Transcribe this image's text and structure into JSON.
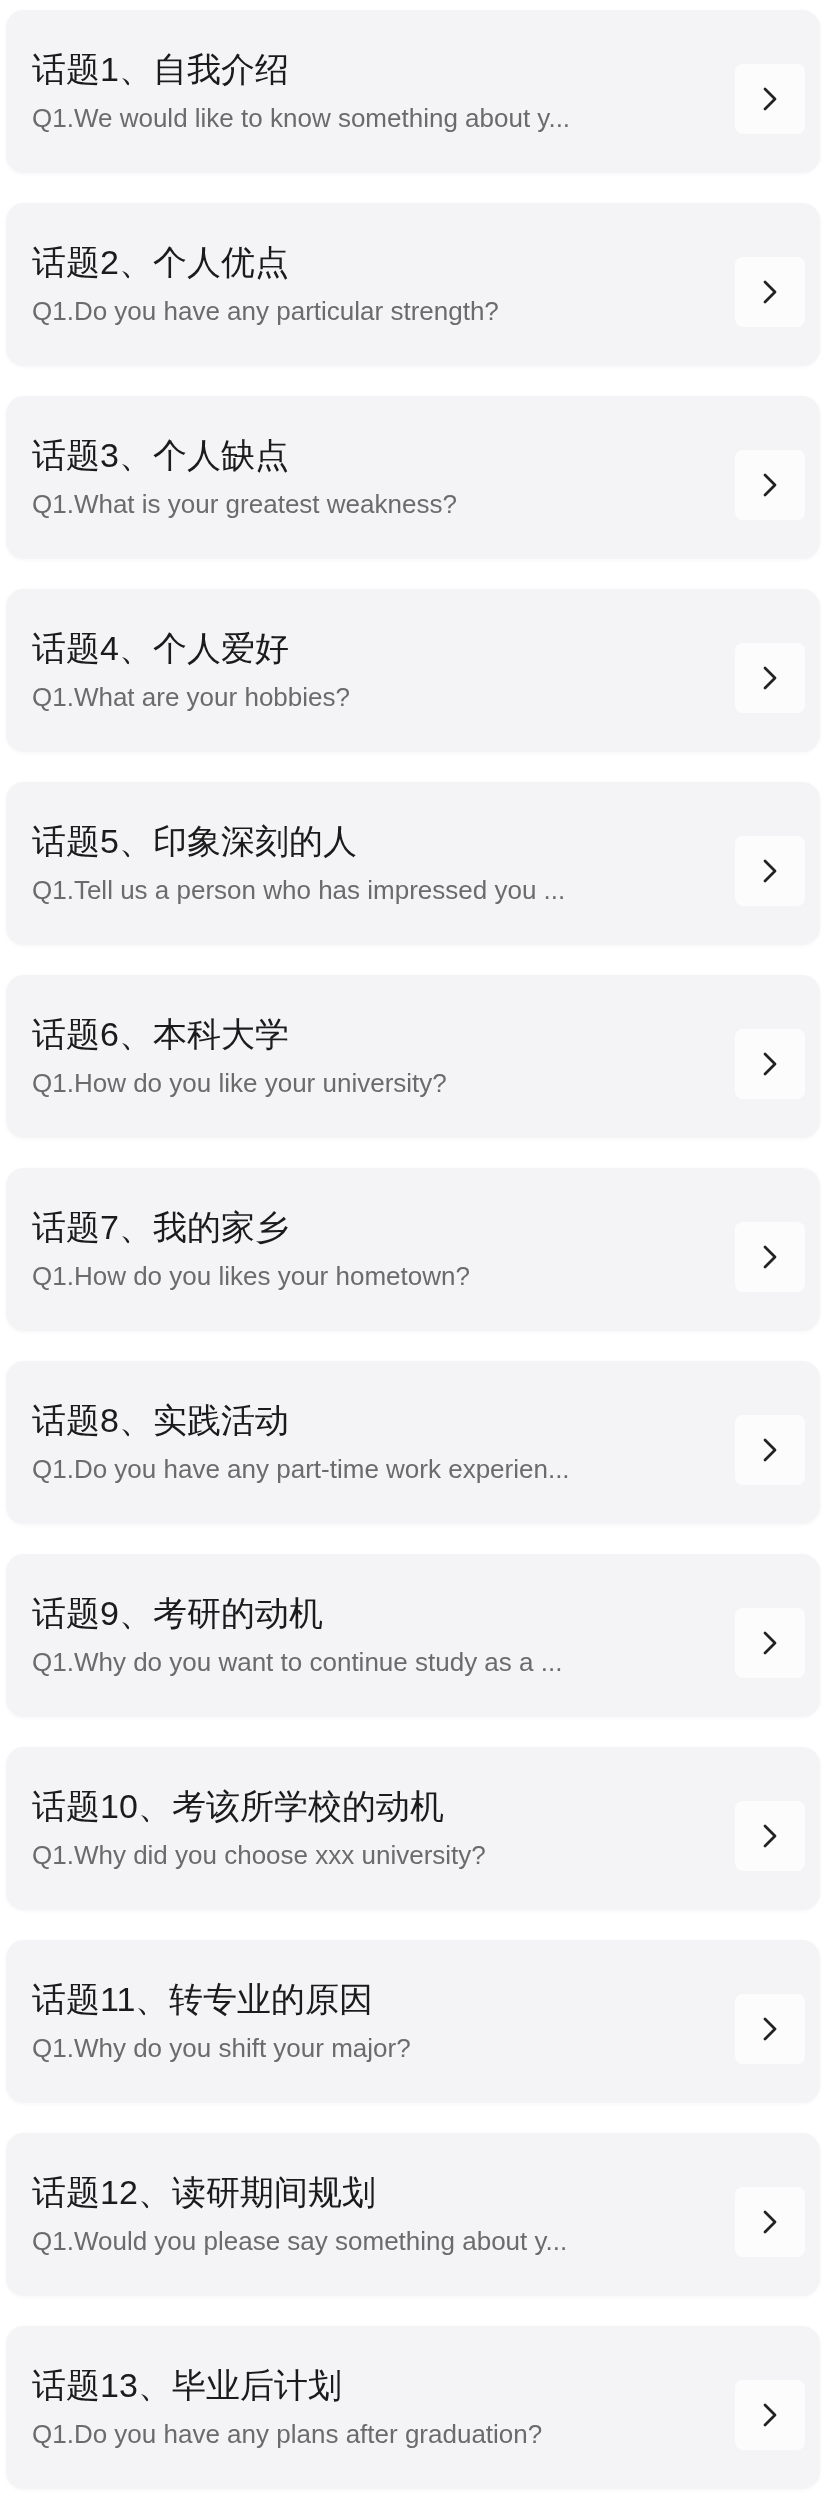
{
  "topics": [
    {
      "title": "话题1、自我介绍",
      "question": "Q1.We would like to know something about y..."
    },
    {
      "title": "话题2、个人优点",
      "question": "Q1.Do you have any particular strength?"
    },
    {
      "title": "话题3、个人缺点",
      "question": "Q1.What is your greatest weakness?"
    },
    {
      "title": "话题4、个人爱好",
      "question": "Q1.What are your hobbies?"
    },
    {
      "title": "话题5、印象深刻的人",
      "question": "Q1.Tell us a person who has impressed you ..."
    },
    {
      "title": "话题6、本科大学",
      "question": "Q1.How do you like your university?"
    },
    {
      "title": "话题7、我的家乡",
      "question": "Q1.How do you likes your hometown?"
    },
    {
      "title": "话题8、实践活动",
      "question": "Q1.Do you have any part-time work experien..."
    },
    {
      "title": "话题9、考研的动机",
      "question": "Q1.Why do you want to continue study as a ..."
    },
    {
      "title": "话题10、考该所学校的动机",
      "question": "Q1.Why did you choose xxx university?"
    },
    {
      "title": "话题11、转专业的原因",
      "question": "Q1.Why do you shift your major?"
    },
    {
      "title": "话题12、读研期间规划",
      "question": "Q1.Would you please say something about y..."
    },
    {
      "title": "话题13、毕业后计划",
      "question": "Q1.Do you have any plans after graduation?"
    }
  ]
}
